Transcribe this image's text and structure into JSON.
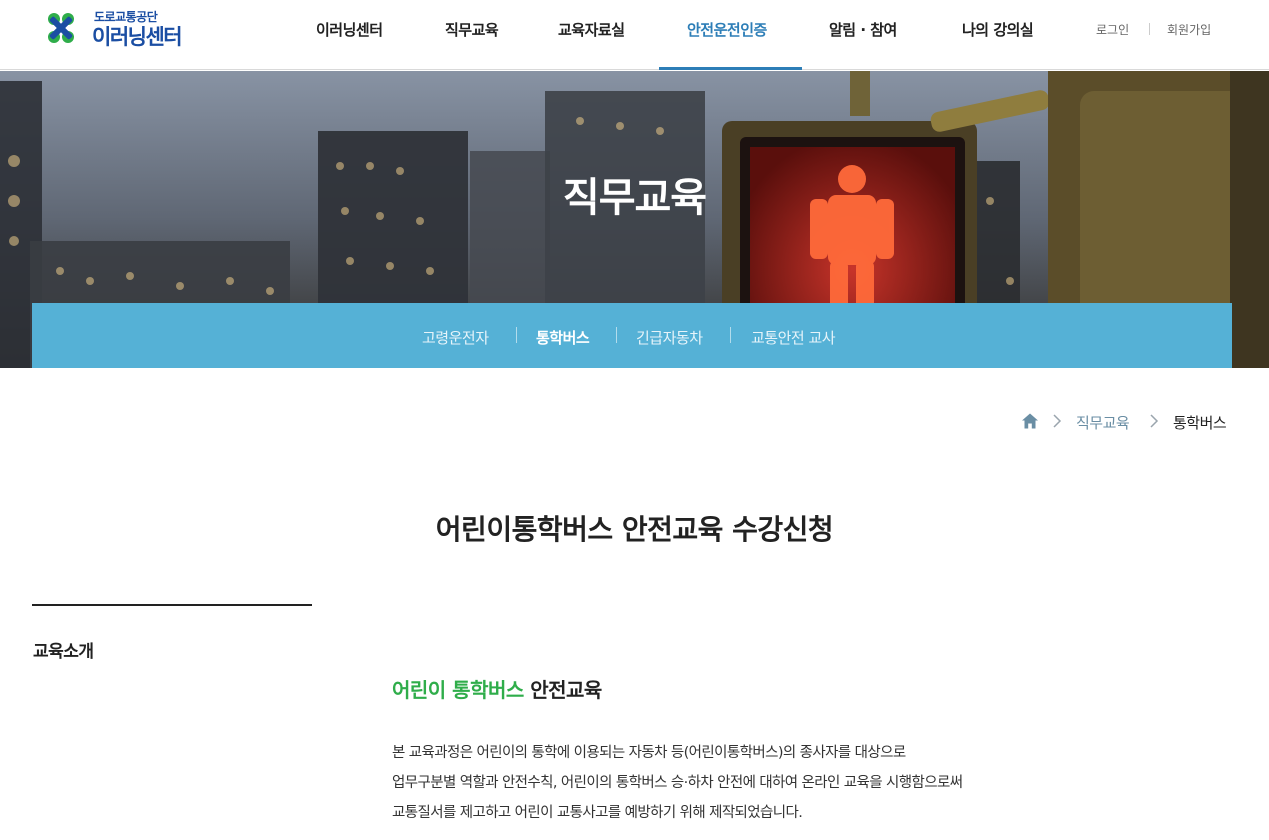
{
  "header": {
    "logo_sub": "도로교통공단",
    "logo_main": "이러닝센터",
    "nav": [
      {
        "label": "이러닝센터"
      },
      {
        "label": "직무교육"
      },
      {
        "label": "교육자료실"
      },
      {
        "label": "안전운전인증",
        "active": true
      },
      {
        "label": "알림 · 참여"
      },
      {
        "label": "나의 강의실"
      }
    ],
    "login": "로그인",
    "signup": "회원가입"
  },
  "hero": {
    "title": "직무교육",
    "tabs": [
      {
        "label": "고령운전자"
      },
      {
        "label": "통학버스",
        "active": true
      },
      {
        "label": "긴급자동차"
      },
      {
        "label": "교통안전 교사"
      }
    ]
  },
  "breadcrumb": {
    "items": [
      "직무교육",
      "통학버스"
    ]
  },
  "page": {
    "title": "어린이통학버스 안전교육 수강신청"
  },
  "sidebar": {
    "items": [
      {
        "label": "교육소개"
      }
    ]
  },
  "content": {
    "section_title_highlight": "어린이 통학버스",
    "section_title_rest": " 안전교육",
    "description": [
      "본 교육과정은 어린이의 통학에 이용되는 자동차 등(어린이통학버스)의 종사자를 대상으로",
      "업무구분별 역할과 안전수칙, 어린이의 통학버스 승·하차 안전에 대하여 온라인 교육을 시행함으로써",
      "교통질서를 제고하고 어린이 교통사고를 예방하기 위해 제작되었습니다."
    ]
  },
  "colors": {
    "brand_blue": "#1b4ea3",
    "logo_green": "#2fad4a",
    "nav_active": "#2d7eb7",
    "tab_bar": "#55b1d6",
    "highlight_green": "#2fad4a"
  },
  "icons": {
    "home": "home-icon",
    "breadcrumb_separator": "chevron-right-icon",
    "logo": "clover-cross-logo"
  }
}
